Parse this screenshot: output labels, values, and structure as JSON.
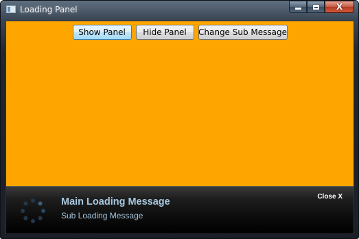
{
  "window": {
    "title": "Loading Panel",
    "icon": "app-window-icon",
    "controls": {
      "minimize": "minimize-icon",
      "maximize": "maximize-icon",
      "close": "close-icon",
      "close_glyph": "X"
    }
  },
  "client": {
    "background": "#ffa500"
  },
  "toolbar": {
    "show_label": "Show Panel",
    "hide_label": "Hide Panel",
    "change_label": "Change Sub Message"
  },
  "loading_panel": {
    "main_message": "Main Loading Message",
    "sub_message": "Sub Loading Message",
    "close_label": "Close X",
    "spinner_icon": "spinner-icon",
    "text_color": "#a8c8df"
  }
}
